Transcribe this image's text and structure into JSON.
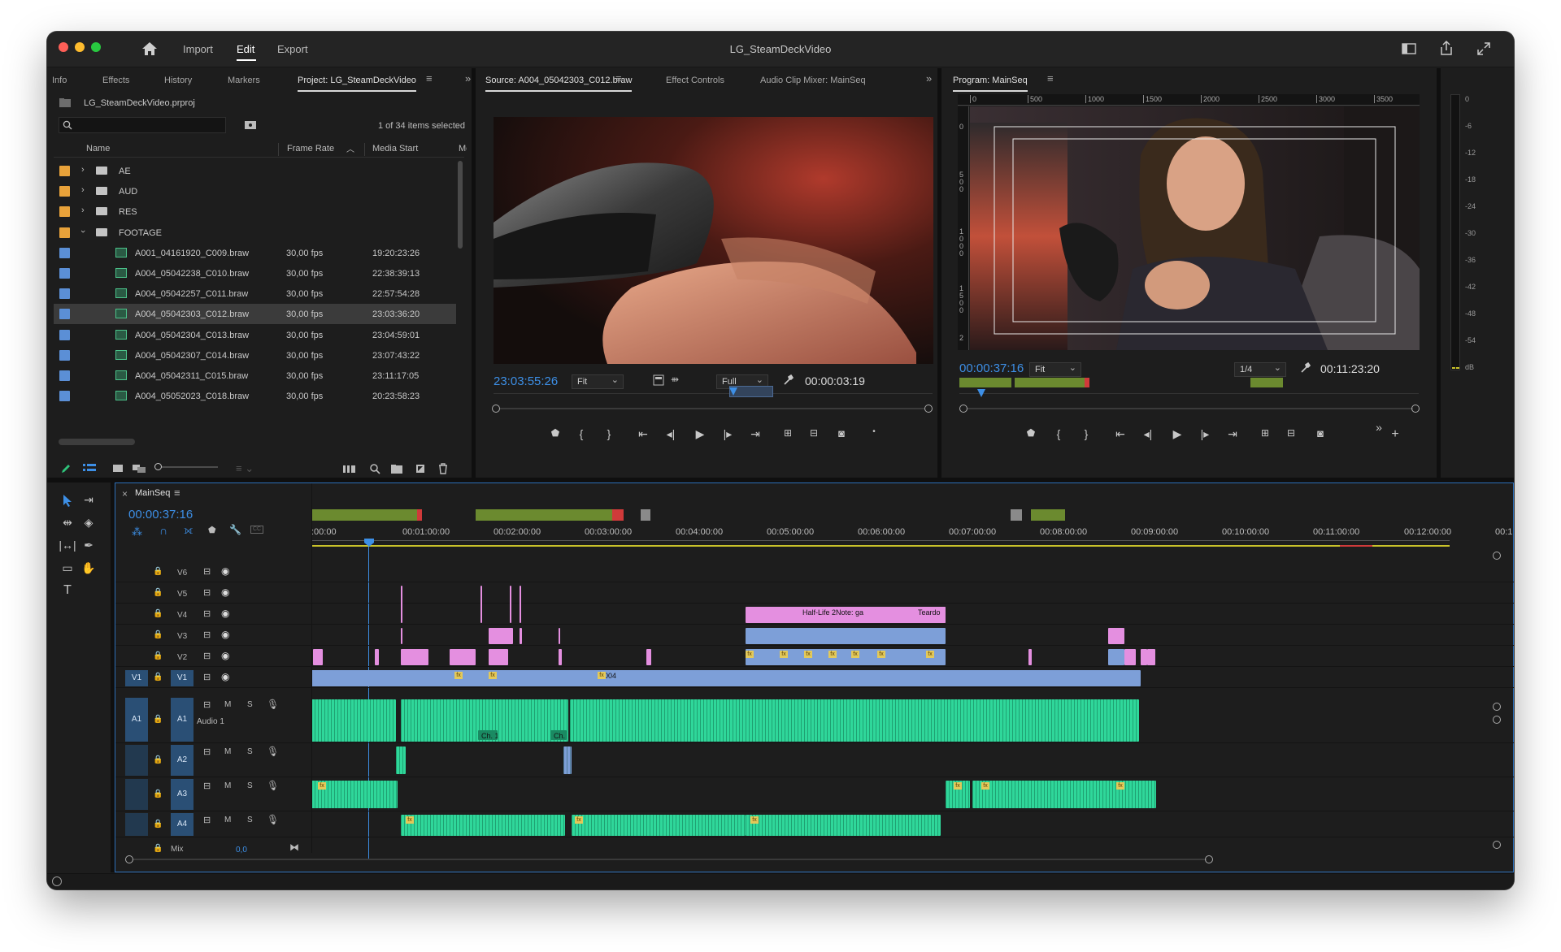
{
  "window": {
    "title": "LG_SteamDeckVideo",
    "menus": [
      "Import",
      "Edit",
      "Export"
    ],
    "active_menu": "Edit"
  },
  "project_panel": {
    "tabs": [
      "Info",
      "Effects",
      "History",
      "Markers",
      "Project: LG_SteamDeckVideo"
    ],
    "active_tab": "Project: LG_SteamDeckVideo",
    "project_file": "LG_SteamDeckVideo.prproj",
    "search_placeholder": "",
    "selection_status": "1 of 34 items selected",
    "columns": [
      "Name",
      "Frame Rate",
      "Media Start",
      "Me"
    ],
    "bins": [
      {
        "name": "AE",
        "color": "#e8a23a",
        "expanded": false
      },
      {
        "name": "AUD",
        "color": "#e8a23a",
        "expanded": false
      },
      {
        "name": "RES",
        "color": "#e8a23a",
        "expanded": false
      },
      {
        "name": "FOOTAGE",
        "color": "#e8a23a",
        "expanded": true
      }
    ],
    "clips": [
      {
        "name": "A001_04161920_C009.braw",
        "frame_rate": "30,00 fps",
        "media_start": "19:20:23:26",
        "color": "#5b8fd6",
        "selected": false
      },
      {
        "name": "A004_05042238_C010.braw",
        "frame_rate": "30,00 fps",
        "media_start": "22:38:39:13",
        "color": "#5b8fd6",
        "selected": false
      },
      {
        "name": "A004_05042257_C011.braw",
        "frame_rate": "30,00 fps",
        "media_start": "22:57:54:28",
        "color": "#5b8fd6",
        "selected": false
      },
      {
        "name": "A004_05042303_C012.braw",
        "frame_rate": "30,00 fps",
        "media_start": "23:03:36:20",
        "color": "#5b8fd6",
        "selected": true
      },
      {
        "name": "A004_05042304_C013.braw",
        "frame_rate": "30,00 fps",
        "media_start": "23:04:59:01",
        "color": "#5b8fd6",
        "selected": false
      },
      {
        "name": "A004_05042307_C014.braw",
        "frame_rate": "30,00 fps",
        "media_start": "23:07:43:22",
        "color": "#5b8fd6",
        "selected": false
      },
      {
        "name": "A004_05042311_C015.braw",
        "frame_rate": "30,00 fps",
        "media_start": "23:11:17:05",
        "color": "#5b8fd6",
        "selected": false
      },
      {
        "name": "A004_05052023_C018.braw",
        "frame_rate": "30,00 fps",
        "media_start": "20:23:58:23",
        "color": "#5b8fd6",
        "selected": false
      }
    ]
  },
  "source_monitor": {
    "tabs": [
      "Source: A004_05042303_C012.braw",
      "Effect Controls",
      "Audio Clip Mixer: MainSeq"
    ],
    "active_tab": "Source: A004_05042303_C012.braw",
    "timecode": "23:03:55:26",
    "zoom": "Fit",
    "resolution": "Full",
    "duration": "00:00:03:19"
  },
  "program_monitor": {
    "tab": "Program: MainSeq",
    "timecode": "00:00:37:16",
    "zoom": "Fit",
    "resolution": "1/4",
    "duration": "00:11:23:20",
    "ruler_h": [
      "0",
      "500",
      "1000",
      "1500",
      "2000",
      "2500",
      "3000",
      "3500"
    ],
    "ruler_v": [
      "0",
      "500",
      "1000",
      "1500",
      "2"
    ],
    "meter_scale": [
      "0",
      "-6",
      "-12",
      "-18",
      "-24",
      "-30",
      "-36",
      "-42",
      "-48",
      "-54",
      "dB"
    ]
  },
  "timeline": {
    "sequence": "MainSeq",
    "timecode": "00:00:37:16",
    "ruler": [
      ":00:00",
      "00:01:00:00",
      "00:02:00:00",
      "00:03:00:00",
      "00:04:00:00",
      "00:05:00:00",
      "00:06:00:00",
      "00:07:00:00",
      "00:08:00:00",
      "00:09:00:00",
      "00:10:00:00",
      "00:11:00:00",
      "00:12:00:00",
      "00:1"
    ],
    "video_tracks": [
      "V6",
      "V5",
      "V4",
      "V3",
      "V2",
      "V1"
    ],
    "audio_tracks": [
      "A1",
      "A2",
      "A3",
      "A4"
    ],
    "source_patch_video": "V1",
    "source_patch_audio": "A1",
    "audio1_name": "Audio 1",
    "mix_label": "Mix",
    "mix_value": "0,0",
    "clip_labels": {
      "v4_title1": "Half-Life 2Note: ga",
      "v4_title2": "Teardo",
      "v1_clip": "A004",
      "a1_ch1": "Ch. 1",
      "a1_ch1b": "Ch. 1"
    },
    "mute_label": "M",
    "solo_label": "S",
    "fx_label": "fx"
  },
  "colors": {
    "accent_blue": "#2d8ceb",
    "video_clip": "#7d9fd8",
    "graphic_clip": "#e48fe0",
    "audio_clip": "#2fd79a",
    "bin_orange": "#e8a23a",
    "panel_bg": "#1d1d1d"
  }
}
